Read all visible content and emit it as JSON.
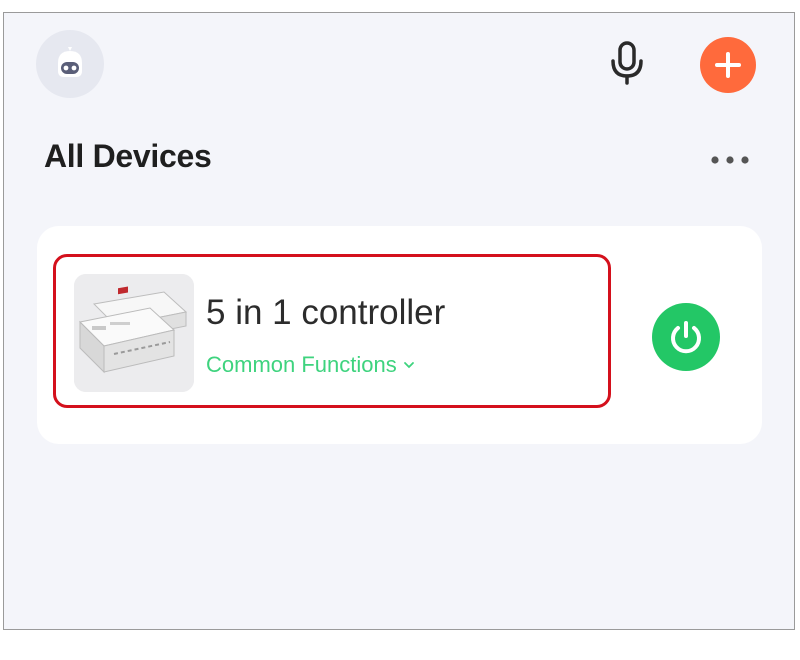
{
  "header": {
    "avatar_icon": "robot-avatar-icon",
    "mic_icon": "microphone-icon",
    "add_icon": "plus-icon",
    "add_color": "#ff6a3c"
  },
  "section": {
    "title": "All Devices",
    "more_icon": "more-horizontal-icon"
  },
  "devices": [
    {
      "name": "5 in 1 controller",
      "common_functions_label": "Common Functions",
      "expand_icon": "chevron-down-icon",
      "power_icon": "power-icon",
      "power_color": "#23c766",
      "thumbnail_icon": "controller-device-image"
    }
  ],
  "colors": {
    "accent_green": "#3ed37e",
    "highlight_red": "#d4101c",
    "background": "#f4f5fa"
  }
}
